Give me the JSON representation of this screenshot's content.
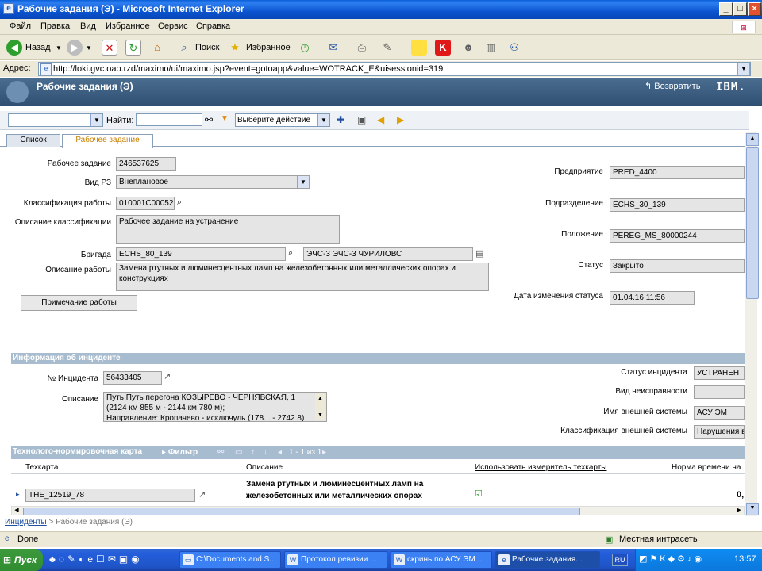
{
  "window": {
    "title": "Рабочие задания (Э) - Microsoft Internet Explorer"
  },
  "menu": [
    "Файл",
    "Правка",
    "Вид",
    "Избранное",
    "Сервис",
    "Справка"
  ],
  "toolbar": {
    "back_label": "Назад",
    "search_label": "Поиск",
    "favorites_label": "Избранное"
  },
  "address": {
    "label": "Адрес:",
    "url": "http://loki.gvc.oao.rzd/maximo/ui/maximo.jsp?event=gotoapp&value=WOTRACK_E&uisessionid=319"
  },
  "app": {
    "title": "Рабочие задания (Э)",
    "return_label": "Возвратить",
    "brand": "IBM."
  },
  "mxtoolbar": {
    "find_label": "Найти:",
    "find_value": "",
    "action_select": "Выберите действие"
  },
  "tabs": [
    {
      "label": "Список"
    },
    {
      "label": "Рабочее задание"
    }
  ],
  "form": {
    "wo_label": "Рабочее задание",
    "wo_value": "246537625",
    "type_label": "Вид РЗ",
    "type_value": "Внеплановое",
    "class_label": "Классификация работы",
    "class_value": "010001C00052",
    "classdesc_label": "Описание классификации",
    "classdesc_value": "Рабочее задание на устранение",
    "crew_label": "Бригада",
    "crew_value": "ECHS_80_139",
    "crew_desc": "ЭЧС-3 ЭЧС-3 ЧУРИЛОВС",
    "desc_label": "Описание работы",
    "desc_value": "Замена ртутных и люминесцентных ламп на железобетонных или металлических опорах и конструкциях",
    "notes_button": "Примечание работы",
    "org_label": "Предприятие",
    "org_value": "PRED_4400",
    "dept_label": "Подразделение",
    "dept_value": "ECHS_30_139",
    "loc_label": "Положение",
    "loc_value": "PEREG_MS_80000244",
    "status_label": "Статус",
    "status_value": "Закрыто",
    "statusdate_label": "Дата изменения статуса",
    "statusdate_value": "01.04.16 11:56"
  },
  "incident": {
    "section_title": "Информация об инциденте",
    "num_label": "№ Инцидента",
    "num_value": "56433405",
    "desc_label": "Описание",
    "desc_lines": [
      "Путь Путь перегона КОЗЫРЕВО - ЧЕРНЯВСКАЯ, 1",
      "(2124 км 855 м - 2144 км 780 м);",
      "Направление: Кропачево - исключуль (178... - 2742 8)"
    ],
    "status_label": "Статус инцидента",
    "status_value": "УСТРАНЕН",
    "fault_label": "Вид неисправности",
    "fault_value": "",
    "extsys_label": "Имя внешней системы",
    "extsys_value": "АСУ ЭМ",
    "extclass_label": "Классификация внешней системы",
    "extclass_value": "Нарушения в"
  },
  "techcard": {
    "section_title": "Технолого-нормировочная карта",
    "filter_label": "Фильтр",
    "pager": "1 - 1 из 1",
    "col_card": "Техкарта",
    "col_desc": "Описание",
    "col_use": "Использовать измеритель техкарты",
    "col_norm": "Норма времени на",
    "row": {
      "card": "ТНЕ_12519_78",
      "desc_line1": "Замена ртутных и люминесцентных ламп на",
      "desc_line2": "железобетонных или металлических опорах",
      "use": true,
      "norm": "0,"
    }
  },
  "breadcrumb": {
    "link": "Инциденты",
    "sep": ">",
    "current": "Рабочие задания (Э)"
  },
  "statusbar": {
    "text": "Done",
    "zone": "Местная интрасеть"
  },
  "taskbar": {
    "start": "Пуск",
    "tasks": [
      "C:\\Documents and S...",
      "Протокол ревизии ...",
      "скринь по АСУ ЭМ ...",
      "Рабочие задания..."
    ],
    "lang": "RU",
    "clock": "13:57"
  }
}
